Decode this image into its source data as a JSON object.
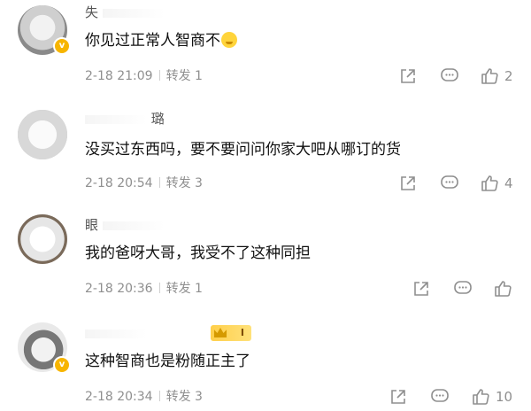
{
  "comments": [
    {
      "user": "失",
      "text": "你见过正常人智商不",
      "emoji": "crying-emoji",
      "time": "2-18 21:09",
      "repost": "转发 1",
      "likes": "2"
    },
    {
      "user": "璐",
      "text": "没买过东西吗，要不要问问你家大吧从哪订的货",
      "time": "2-18 20:54",
      "repost": "转发 3",
      "likes": "4"
    },
    {
      "user": "眼",
      "text": "我的爸呀大哥，我受不了这种同担",
      "time": "2-18 20:36",
      "repost": "转发 1",
      "likes": ""
    },
    {
      "user": "",
      "badge": "I",
      "text": "这种智商也是粉随正主了",
      "time": "2-18 20:34",
      "repost": "转发 3",
      "likes": "10"
    }
  ],
  "icons": {
    "share": "share-icon",
    "comment": "comment-icon",
    "like": "thumbs-up-icon",
    "verified": "verified-badge-icon"
  },
  "colors": {
    "text": "#111111",
    "meta": "#8f8f8f",
    "verified": "#f7b500",
    "crown": "#ffcf4a"
  }
}
